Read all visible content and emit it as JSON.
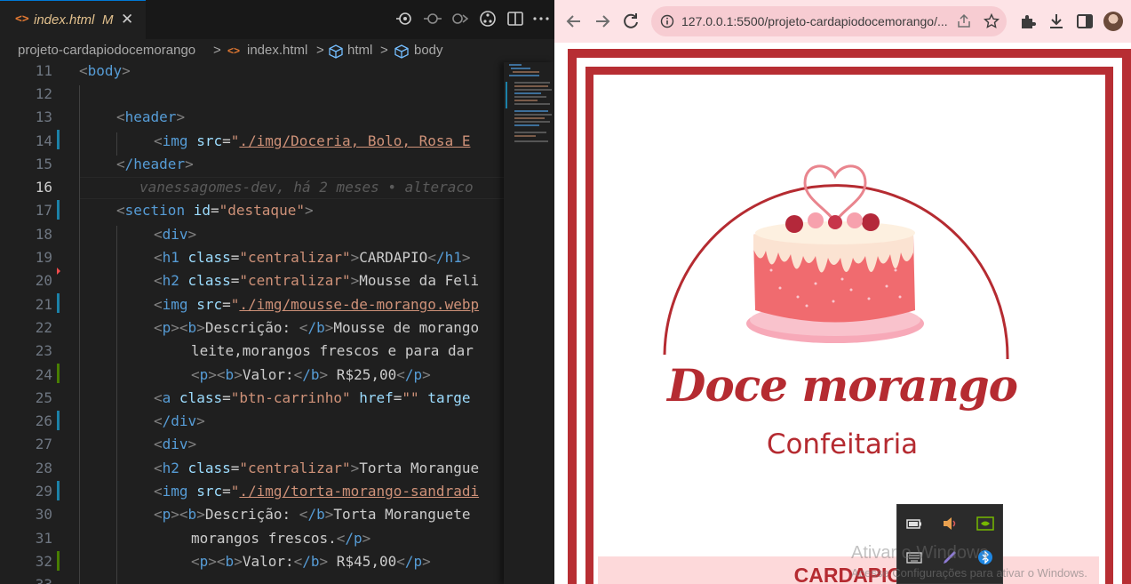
{
  "editor": {
    "tab": {
      "icon": "<>",
      "filename": "index.html",
      "modified_flag": "M"
    },
    "actions": [
      "open-changes-icon",
      "previous-change-icon",
      "next-change-icon",
      "source-control-icon",
      "split-editor-icon",
      "more-actions-icon"
    ],
    "breadcrumb": {
      "folder": "projeto-cardapiodocemorango",
      "file": "index.html",
      "element1": "html",
      "element2": "body",
      "separator": ">"
    },
    "current_line": 16,
    "blame": "vanessagomes-dev, há 2 meses • alteraco",
    "lines": [
      {
        "n": "11"
      },
      {
        "n": "12"
      },
      {
        "n": "13"
      },
      {
        "n": "14"
      },
      {
        "n": "15"
      },
      {
        "n": "16"
      },
      {
        "n": "17"
      },
      {
        "n": "18"
      },
      {
        "n": "19"
      },
      {
        "n": "20"
      },
      {
        "n": "21"
      },
      {
        "n": "22"
      },
      {
        "n": "23"
      },
      {
        "n": "24"
      },
      {
        "n": "25"
      },
      {
        "n": "26"
      },
      {
        "n": "27"
      },
      {
        "n": "28"
      },
      {
        "n": "29"
      },
      {
        "n": "30"
      },
      {
        "n": "31"
      },
      {
        "n": "32"
      },
      {
        "n": "33"
      }
    ],
    "code": {
      "l11": {
        "tag": "body"
      },
      "l13": {
        "tag": "header"
      },
      "l14": {
        "tag": "img",
        "attr": "src",
        "val": "./img/Doceria, Bolo, Rosa E"
      },
      "l15": {
        "tag": "/header"
      },
      "l17": {
        "tag": "section",
        "attr": "id",
        "val": "destaque"
      },
      "l18": {
        "tag": "div"
      },
      "l19": {
        "tag": "h1",
        "attr": "class",
        "val": "centralizar",
        "text": "CARDAPIO",
        "close": "/h1"
      },
      "l20": {
        "tag": "h2",
        "attr": "class",
        "val": "centralizar",
        "text": "Mousse da Feli"
      },
      "l21": {
        "tag": "img",
        "attr": "src",
        "val": "./img/mousse-de-morango.webp"
      },
      "l22": {
        "tag1": "p",
        "tag2": "b",
        "label": "Descrição: ",
        "close": "/b",
        "text": "Mousse de morango"
      },
      "l23": {
        "text": "leite,morangos frescos e para dar"
      },
      "l24": {
        "tag1": "p",
        "tag2": "b",
        "label": "Valor:",
        "close": "/b",
        "text": " R$25,00",
        "close2": "/p"
      },
      "l25": {
        "tag": "a",
        "attr": "class",
        "val": "btn-carrinho",
        "attr2": "href",
        "val2": "",
        "attr3": "targe"
      },
      "l26": {
        "tag": "/div"
      },
      "l27": {
        "tag": "div"
      },
      "l28": {
        "tag": "h2",
        "attr": "class",
        "val": "centralizar",
        "text": "Torta Morangue"
      },
      "l29": {
        "tag": "img",
        "attr": "src",
        "val": "./img/torta-morango-sandradi"
      },
      "l30": {
        "tag1": "p",
        "tag2": "b",
        "label": "Descrição: ",
        "close": "/b",
        "text": "Torta Moranguete"
      },
      "l31": {
        "text": "morangos frescos.",
        "close": "/p"
      },
      "l32": {
        "tag1": "p",
        "tag2": "b",
        "label": "Valor:",
        "close": "/b",
        "text": " R$45,00",
        "close2": "/p"
      }
    },
    "colors": {
      "background": "#1f1f1f",
      "tag": "#569cd6",
      "attribute": "#9cdcfe",
      "string": "#ce9178",
      "text": "#cccccc"
    }
  },
  "browser": {
    "url": "127.0.0.1:5500/projeto-cardapiodocemorango/...",
    "toolbar_icons": [
      "back-icon",
      "forward-icon",
      "reload-icon",
      "site-info-icon",
      "share-icon",
      "bookmark-star-icon",
      "extensions-icon",
      "download-icon",
      "side-panel-icon",
      "profile-avatar"
    ],
    "page": {
      "brand": "Doce morango",
      "subtitle": "Confeitaria",
      "section_title": "CARDAPIO"
    },
    "colors": {
      "accent": "#b72e33",
      "toolbar": "#fde3e6",
      "band": "#fdd9da"
    }
  },
  "system": {
    "tray_icons": [
      "battery-icon",
      "volume-icon",
      "nvidia-icon",
      "keyboard-icon",
      "pen-icon",
      "bluetooth-icon"
    ],
    "watermark_title": "Ativar o Windows",
    "watermark_sub": "Acesse Configurações para ativar o Windows."
  }
}
